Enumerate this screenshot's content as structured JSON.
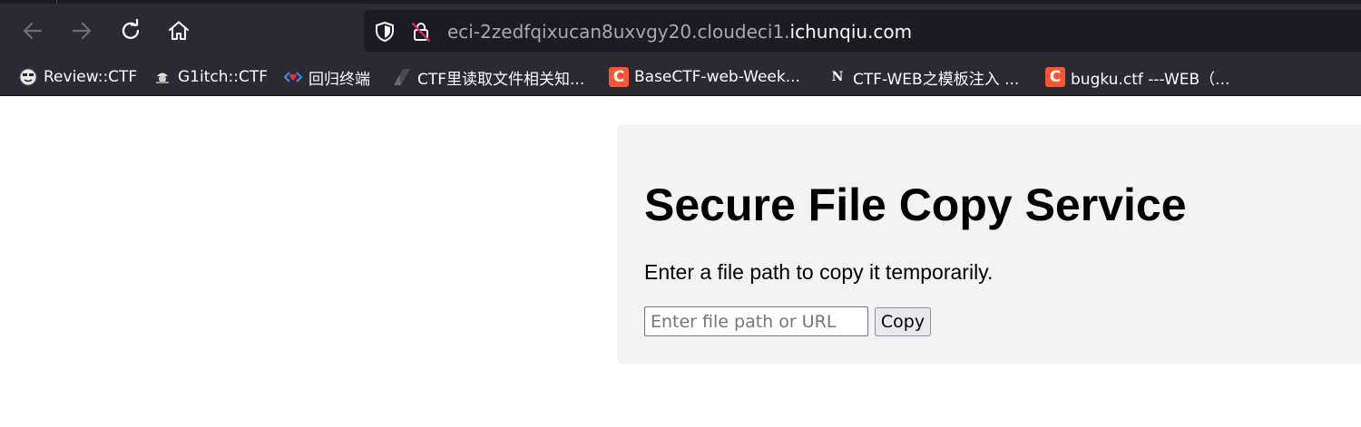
{
  "toolbar": {
    "icons": [
      "back-arrow-icon",
      "forward-arrow-icon",
      "reload-icon",
      "home-icon"
    ],
    "urlbar": {
      "security_icons": [
        "shield-icon",
        "insecure-lock-icon"
      ],
      "url_prefix": "eci-2zedfqixucan8uxvgy20.cloudeci1.",
      "url_domain": "ichunqiu.com"
    }
  },
  "bookmarks": [
    {
      "label": "Review::CTF",
      "icon": "smiley-icon"
    },
    {
      "label": "G1itch::CTF",
      "icon": "pirate-icon"
    },
    {
      "label": "回归终端",
      "icon": "code-heart-icon"
    },
    {
      "label": "CTF里读取文件相关知...",
      "icon": "zhihu-stripe-icon"
    },
    {
      "label": "BaseCTF-web-Week...",
      "icon": "csdn-c-icon",
      "icon_text": "C"
    },
    {
      "label": "CTF-WEB之模板注入 ...",
      "icon": "notion-n-icon",
      "icon_text": "N"
    },
    {
      "label": "bugku.ctf ---WEB（...",
      "icon": "csdn-c-icon",
      "icon_text": "C"
    }
  ],
  "page": {
    "title": "Secure File Copy Service",
    "description": "Enter a file path to copy it temporarily.",
    "input": {
      "placeholder": "Enter file path or URL",
      "value": ""
    },
    "button_label": "Copy"
  },
  "colors": {
    "chrome_bg": "#2b2a33",
    "urlbar_bg": "#1c1b22",
    "card_bg": "#f3f3f3",
    "csdn_icon": "#fc5531"
  }
}
